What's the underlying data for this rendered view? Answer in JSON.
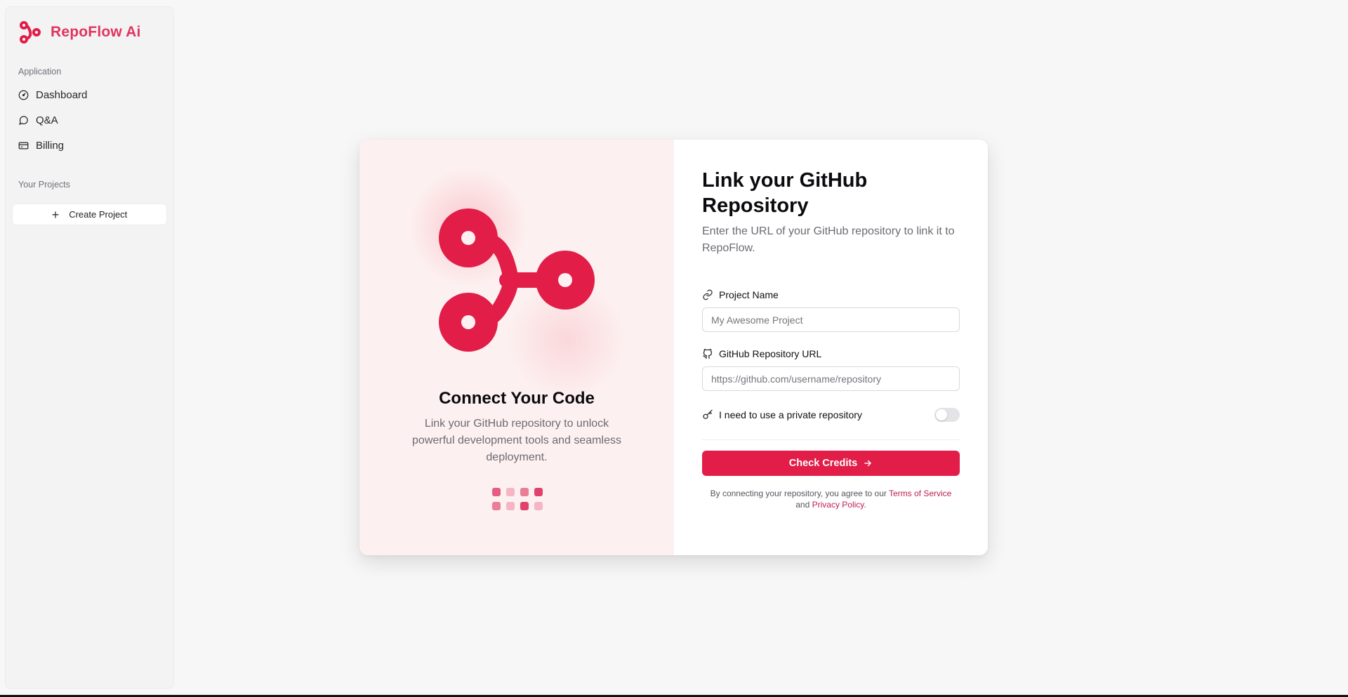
{
  "brand": {
    "name": "RepoFlow Ai",
    "color": "#e0345e"
  },
  "sidebar": {
    "section_application": "Application",
    "items": [
      {
        "label": "Dashboard",
        "icon": "dashboard-gauge-icon"
      },
      {
        "label": "Q&A",
        "icon": "message-circle-icon"
      },
      {
        "label": "Billing",
        "icon": "credit-card-icon"
      }
    ],
    "section_projects": "Your Projects",
    "create_project_label": "Create Project"
  },
  "hero": {
    "title": "Connect Your Code",
    "description": "Link your GitHub repository to unlock powerful development tools and seamless deployment.",
    "accent": "#e11d48"
  },
  "form": {
    "title": "Link your GitHub Repository",
    "subtitle": "Enter the URL of your GitHub repository to link it to RepoFlow.",
    "project_name_label": "Project Name",
    "project_name_placeholder": "My Awesome Project",
    "project_name_value": "",
    "repo_url_label": "GitHub Repository URL",
    "repo_url_placeholder": "https://github.com/username/repository",
    "repo_url_value": "",
    "private_repo_label": "I need to use a private repository",
    "private_repo_enabled": false,
    "submit_label": "Check Credits",
    "legal_prefix": "By connecting your repository, you agree to our",
    "terms_label": "Terms of Service",
    "legal_and": "and",
    "privacy_label": "Privacy Policy",
    "legal_suffix": "."
  }
}
